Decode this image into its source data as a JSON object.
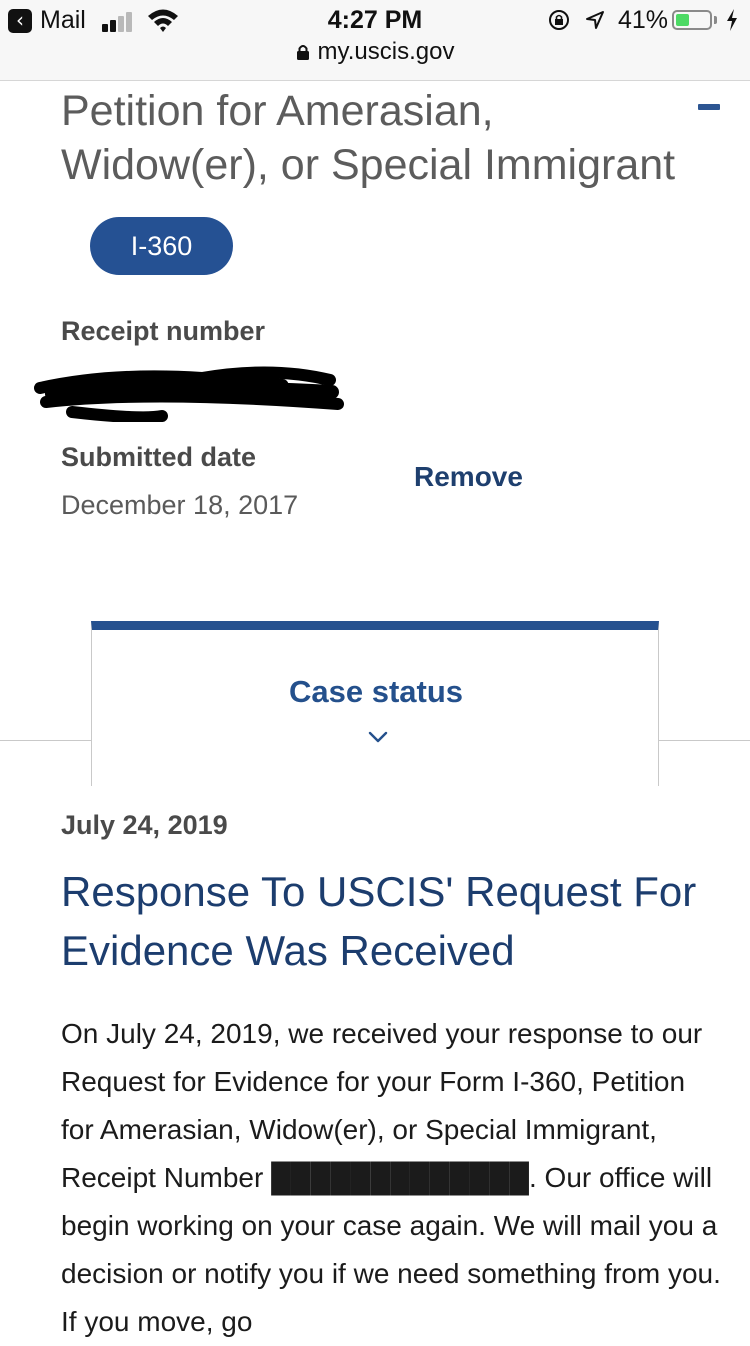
{
  "status_bar": {
    "back_app": "Mail",
    "time": "4:27 PM",
    "battery_percent": "41%",
    "battery_level": 0.41,
    "signal_bars": 2
  },
  "url_bar": {
    "domain": "my.uscis.gov"
  },
  "case": {
    "title": "Petition for Amerasian, Widow(er), or Special Immigrant",
    "form_number": "I-360",
    "receipt_label": "Receipt number",
    "submitted_label": "Submitted date",
    "submitted_date": "December 18, 2017",
    "remove_label": "Remove"
  },
  "case_status": {
    "tab_label": "Case status",
    "date": "July 24, 2019",
    "heading": "Response To USCIS' Request For Evidence Was Received",
    "body": "On July 24, 2019, we received your response to our Request for Evidence for your Form I-360, Petition for Amerasian, Widow(er), or Special Immigrant, Receipt Number █████████████. Our office will begin working on your case again. We will mail you a decision or notify you if we need something from you. If you move, go"
  },
  "colors": {
    "accent": "#255193",
    "heading": "#1c3d6e",
    "title_gray": "#5c5c5c"
  }
}
